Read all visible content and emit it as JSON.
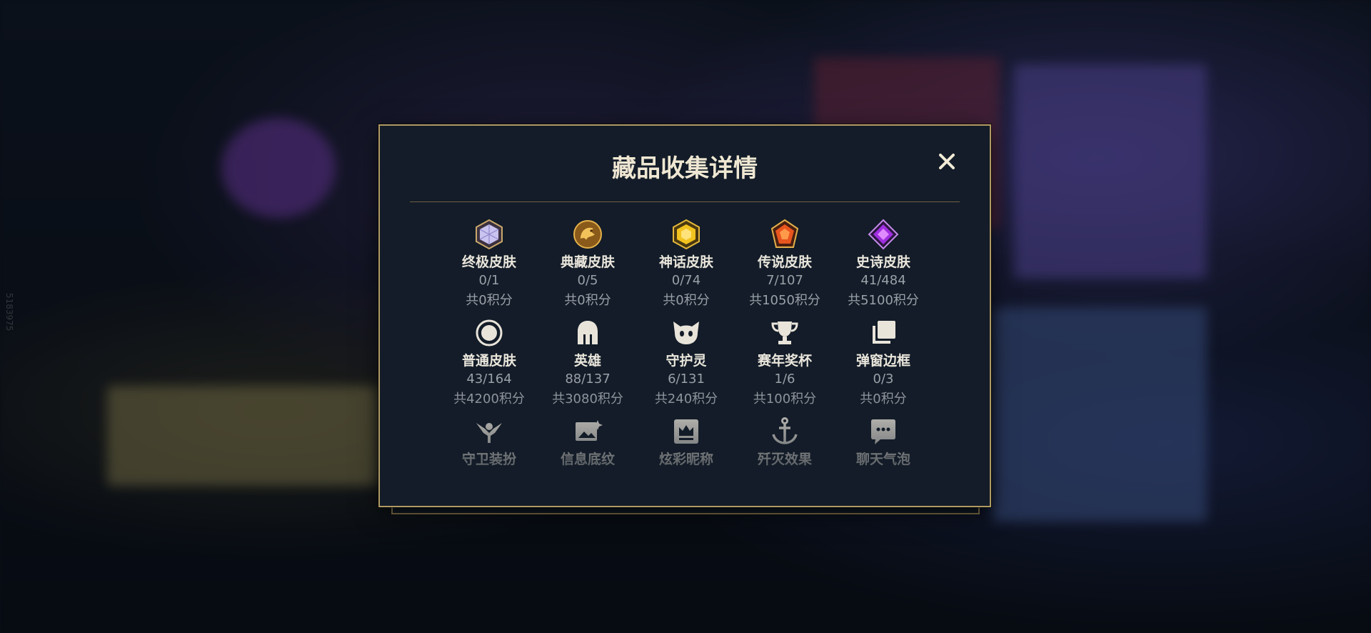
{
  "background": {
    "side_id": "5183975"
  },
  "modal": {
    "title": "藏品收集详情",
    "close_label": "✕",
    "rows": [
      [
        {
          "name": "终极皮肤",
          "count": "0/1",
          "points": "共0积分",
          "icon": "ultimate-gem-icon"
        },
        {
          "name": "典藏皮肤",
          "count": "0/5",
          "points": "共0积分",
          "icon": "dragon-emblem-icon"
        },
        {
          "name": "神话皮肤",
          "count": "0/74",
          "points": "共0积分",
          "icon": "mythic-gem-icon"
        },
        {
          "name": "传说皮肤",
          "count": "7/107",
          "points": "共1050积分",
          "icon": "legendary-gem-icon"
        },
        {
          "name": "史诗皮肤",
          "count": "41/484",
          "points": "共5100积分",
          "icon": "epic-gem-icon"
        }
      ],
      [
        {
          "name": "普通皮肤",
          "count": "43/164",
          "points": "共4200积分",
          "icon": "standard-circle-icon"
        },
        {
          "name": "英雄",
          "count": "88/137",
          "points": "共3080积分",
          "icon": "helmet-icon"
        },
        {
          "name": "守护灵",
          "count": "6/131",
          "points": "共240积分",
          "icon": "guardian-face-icon"
        },
        {
          "name": "赛年奖杯",
          "count": "1/6",
          "points": "共100积分",
          "icon": "trophy-icon"
        },
        {
          "name": "弹窗边框",
          "count": "0/3",
          "points": "共0积分",
          "icon": "frames-icon"
        }
      ],
      [
        {
          "name": "守卫装扮",
          "count": "",
          "points": "",
          "icon": "ward-icon"
        },
        {
          "name": "信息底纹",
          "count": "",
          "points": "",
          "icon": "banner-image-icon"
        },
        {
          "name": "炫彩昵称",
          "count": "",
          "points": "",
          "icon": "crown-card-icon"
        },
        {
          "name": "歼灭效果",
          "count": "",
          "points": "",
          "icon": "anchor-icon"
        },
        {
          "name": "聊天气泡",
          "count": "",
          "points": "",
          "icon": "chat-bubble-icon"
        }
      ]
    ]
  },
  "colors": {
    "gold_border": "#b19a63",
    "panel_bg": "#131c28",
    "title_text": "#efe7d2",
    "secondary_text": "#9aa0a8"
  }
}
